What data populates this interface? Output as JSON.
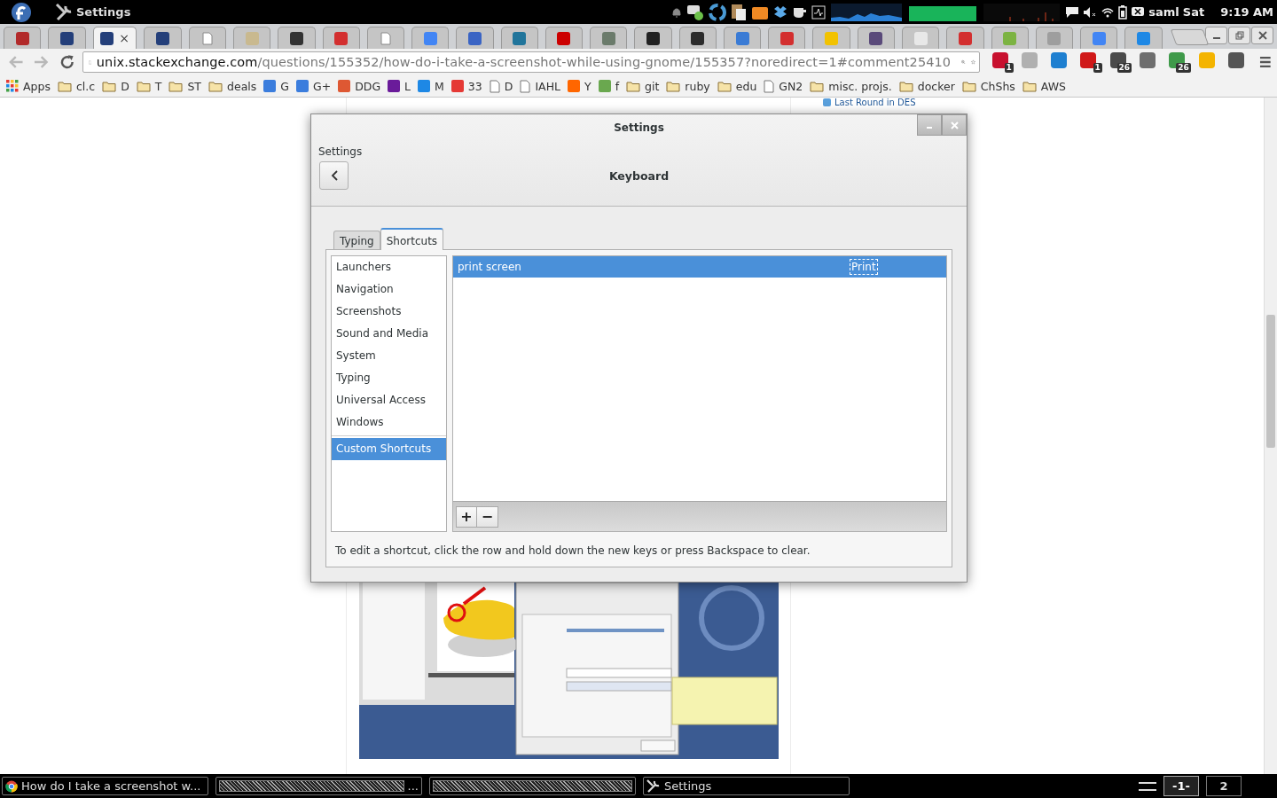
{
  "top_bar": {
    "app_name": "Settings",
    "user": "saml",
    "day": "Sat",
    "time": "9:19 AM"
  },
  "browser": {
    "tabs": [
      {
        "kind": "site",
        "color": "#b22a2a",
        "selected": false
      },
      {
        "kind": "site",
        "color": "#243f7a",
        "selected": false
      },
      {
        "kind": "site",
        "color": "#243f7a",
        "selected": true
      },
      {
        "kind": "site",
        "color": "#243f7a",
        "selected": false
      },
      {
        "kind": "page",
        "selected": false
      },
      {
        "kind": "site",
        "color": "#c9b98f",
        "selected": false
      },
      {
        "kind": "site",
        "color": "#333333",
        "selected": false
      },
      {
        "kind": "site",
        "color": "#d32f2f",
        "selected": false
      },
      {
        "kind": "page",
        "selected": false
      },
      {
        "kind": "site",
        "color": "#4285f4",
        "selected": false
      },
      {
        "kind": "site",
        "color": "#3a64c4",
        "selected": false
      },
      {
        "kind": "site",
        "color": "#21759b",
        "selected": false
      },
      {
        "kind": "site",
        "color": "#cc0000",
        "selected": false
      },
      {
        "kind": "site",
        "color": "#6b7b6b",
        "selected": false
      },
      {
        "kind": "site",
        "color": "#222222",
        "selected": false
      },
      {
        "kind": "site",
        "color": "#2b2b2b",
        "selected": false
      },
      {
        "kind": "site",
        "color": "#3a7bd5",
        "selected": false
      },
      {
        "kind": "site",
        "color": "#d32f2f",
        "selected": false
      },
      {
        "kind": "site",
        "color": "#f2c200",
        "selected": false
      },
      {
        "kind": "site",
        "color": "#5a4a7a",
        "selected": false
      },
      {
        "kind": "site",
        "color": "#e8e8e8",
        "selected": false
      },
      {
        "kind": "site",
        "color": "#d32f2f",
        "selected": false
      },
      {
        "kind": "site",
        "color": "#7cb342",
        "selected": false
      },
      {
        "kind": "site",
        "color": "#9e9e9e",
        "selected": false
      },
      {
        "kind": "site",
        "color": "#4285f4",
        "selected": false
      },
      {
        "kind": "site",
        "color": "#1e88e5",
        "selected": false
      }
    ],
    "close_tab": "×",
    "url_host": "unix.stackexchange.com",
    "url_path": "/questions/155352/how-do-i-take-a-screenshot-while-using-gnome/155357?noredirect=1#comment25410",
    "extensions": [
      {
        "color": "#c8102e",
        "badge": "1"
      },
      {
        "color": "#b0b0b0"
      },
      {
        "color": "#1e7fd0"
      },
      {
        "color": "#d01818",
        "badge": "1"
      },
      {
        "color": "#4a4a4a",
        "badge": "26"
      },
      {
        "color": "#6e6e6e"
      },
      {
        "color": "#3f9a4a",
        "badge": "26"
      },
      {
        "color": "#f4b400"
      },
      {
        "color": "#555555"
      }
    ],
    "bookmarks": [
      {
        "kind": "apps",
        "label": "Apps"
      },
      {
        "kind": "folder",
        "label": "cl.c"
      },
      {
        "kind": "folder",
        "label": "D"
      },
      {
        "kind": "folder",
        "label": "T"
      },
      {
        "kind": "folder",
        "label": "ST"
      },
      {
        "kind": "folder",
        "label": "deals"
      },
      {
        "kind": "site",
        "label": "G",
        "color": "#3b7ddd"
      },
      {
        "kind": "site",
        "label": "G+",
        "color": "#3b7ddd"
      },
      {
        "kind": "site",
        "label": "DDG",
        "color": "#de5833"
      },
      {
        "kind": "site",
        "label": "L",
        "color": "#6a1b9a"
      },
      {
        "kind": "site",
        "label": "M",
        "color": "#1e88e5"
      },
      {
        "kind": "site",
        "label": "33",
        "color": "#e53935"
      },
      {
        "kind": "page",
        "label": "D"
      },
      {
        "kind": "page",
        "label": "IAHL"
      },
      {
        "kind": "site",
        "label": "Y",
        "color": "#ff6600"
      },
      {
        "kind": "site",
        "label": "f",
        "color": "#6aa84f"
      },
      {
        "kind": "folder",
        "label": "git"
      },
      {
        "kind": "folder",
        "label": "ruby"
      },
      {
        "kind": "folder",
        "label": "edu"
      },
      {
        "kind": "page",
        "label": "GN2"
      },
      {
        "kind": "folder",
        "label": "misc. projs."
      },
      {
        "kind": "folder",
        "label": "docker"
      },
      {
        "kind": "folder",
        "label": "ChShs"
      },
      {
        "kind": "folder",
        "label": "AWS"
      }
    ]
  },
  "page": {
    "link": "Last Round in DES"
  },
  "dialog": {
    "title": "Settings",
    "breadcrumb": "Settings",
    "panel_title": "Keyboard",
    "tabs": [
      {
        "label": "Typing",
        "selected": false
      },
      {
        "label": "Shortcuts",
        "selected": true
      }
    ],
    "category_groups": [
      [
        {
          "label": "Launchers",
          "selected": false
        },
        {
          "label": "Navigation",
          "selected": false
        },
        {
          "label": "Screenshots",
          "selected": false
        },
        {
          "label": "Sound and Media",
          "selected": false
        },
        {
          "label": "System",
          "selected": false
        },
        {
          "label": "Typing",
          "selected": false
        },
        {
          "label": "Universal Access",
          "selected": false
        },
        {
          "label": "Windows",
          "selected": false
        }
      ],
      [
        {
          "label": "Custom Shortcuts",
          "selected": true
        }
      ]
    ],
    "shortcuts": [
      {
        "name": "print screen",
        "accelerator": "Print",
        "selected": true
      }
    ],
    "add": "+",
    "remove": "−",
    "hint": "To edit a shortcut, click the row and hold down the new keys or press Backspace to clear."
  },
  "taskbar": {
    "items": [
      {
        "kind": "browser",
        "label": "How do I take a screenshot w..."
      },
      {
        "kind": "obscured",
        "label": "..."
      },
      {
        "kind": "obscured"
      },
      {
        "kind": "settings",
        "label": "Settings"
      }
    ],
    "workspaces": [
      {
        "label": "-1-",
        "selected": true
      },
      {
        "label": "2",
        "selected": false
      }
    ]
  }
}
